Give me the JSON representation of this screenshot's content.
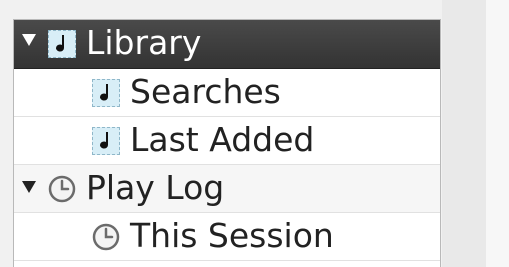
{
  "tree": {
    "items": [
      {
        "label": "Library",
        "icon": "music-note-icon",
        "expanded": true,
        "selected": true
      },
      {
        "label": "Searches",
        "icon": "music-note-icon"
      },
      {
        "label": "Last Added",
        "icon": "music-note-icon"
      },
      {
        "label": "Play Log",
        "icon": "clock-icon",
        "expanded": true
      },
      {
        "label": "This Session",
        "icon": "clock-icon"
      }
    ]
  },
  "colors": {
    "selected_row": "#3b3b3b",
    "note_icon_bg": "#d8eef7",
    "text": "#222222"
  }
}
